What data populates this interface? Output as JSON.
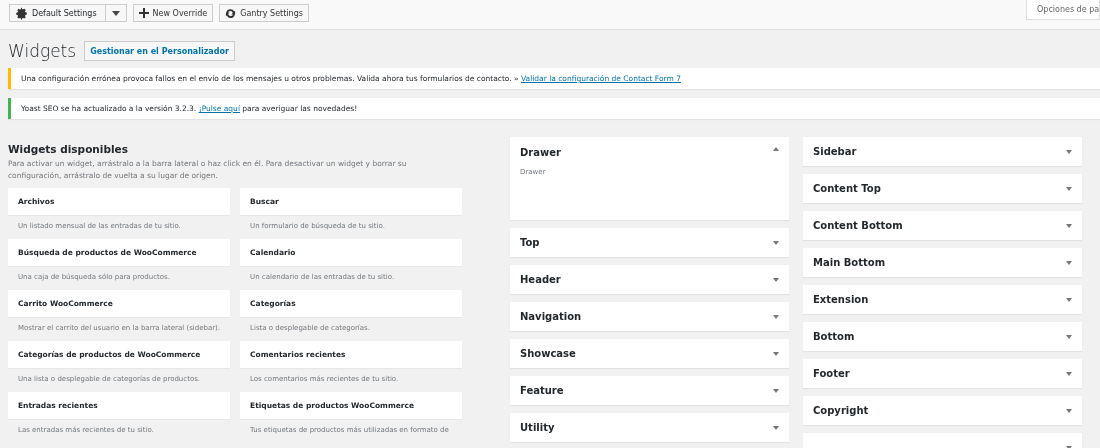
{
  "toolbar": {
    "settings_select": "Default Settings",
    "buttons": [
      {
        "kind": "plus",
        "label": "New Override"
      },
      {
        "kind": "sync",
        "label": "Gantry Settings"
      }
    ],
    "screen_options": "Opciones de pa"
  },
  "page": {
    "title": "Widgets",
    "action": "Gestionar en el Personalizador"
  },
  "notices": [
    {
      "kind": "warning",
      "text": "Una configuración errónea provoca fallos en el envío de los mensajes u otros problemas. Valida ahora tus formularios de contacto. » ",
      "link": "Validar la configuración de Contact Form 7"
    },
    {
      "kind": "success",
      "text": "Yoast SEO se ha actualizado a la versión 3.2.3. ",
      "link": "¡Pulse aquí",
      "after": " para averiguar las novedades!"
    }
  ],
  "available": {
    "title": "Widgets disponibles",
    "description": "Para activar un widget, arrástralo a la barra lateral o haz click en él. Para desactivar un widget y borrar su configuración, arrástralo de vuelta a su lugar de origen.",
    "widgets": [
      {
        "name": "Archivos",
        "description": "Un listado mensual de las entradas de tu sitio."
      },
      {
        "name": "Buscar",
        "description": "Un formulario de búsqueda de tu sitio."
      },
      {
        "name": "Búsqueda de productos de WooCommerce",
        "description": "Una caja de búsqueda sólo para productos."
      },
      {
        "name": "Calendario",
        "description": "Un calendario de las entradas de tu sitio."
      },
      {
        "name": "Carrito WooCommerce",
        "description": "Mostrar el carrito del usuario en la barra lateral (sidebar)."
      },
      {
        "name": "Categorías",
        "description": "Lista o desplegable de categorías."
      },
      {
        "name": "Categorías de productos de WooCommerce",
        "description": "Una lista o desplegable de categorías de productos."
      },
      {
        "name": "Comentarios recientes",
        "description": "Los comentarios más recientes de tu sitio."
      },
      {
        "name": "Entradas recientes",
        "description": "Las entradas más recientes de tu sitio."
      },
      {
        "name": "Etiquetas de productos WooCommerce",
        "description": "Tus etiquetas de productos más utilizadas en formato de"
      }
    ]
  },
  "sidebar_columns": [
    {
      "sidebars": [
        {
          "title": "Drawer",
          "expanded": true,
          "description": "Drawer"
        },
        {
          "title": "Top",
          "expanded": false
        },
        {
          "title": "Header",
          "expanded": false
        },
        {
          "title": "Navigation",
          "expanded": false
        },
        {
          "title": "Showcase",
          "expanded": false
        },
        {
          "title": "Feature",
          "expanded": false
        },
        {
          "title": "Utility",
          "expanded": false
        }
      ]
    },
    {
      "sidebars": [
        {
          "title": "Sidebar",
          "expanded": false
        },
        {
          "title": "Content Top",
          "expanded": false
        },
        {
          "title": "Content Bottom",
          "expanded": false
        },
        {
          "title": "Main Bottom",
          "expanded": false
        },
        {
          "title": "Extension",
          "expanded": false
        },
        {
          "title": "Bottom",
          "expanded": false
        },
        {
          "title": "Footer",
          "expanded": false
        },
        {
          "title": "Copyright",
          "expanded": false
        },
        {
          "expanded": false
        }
      ]
    }
  ]
}
